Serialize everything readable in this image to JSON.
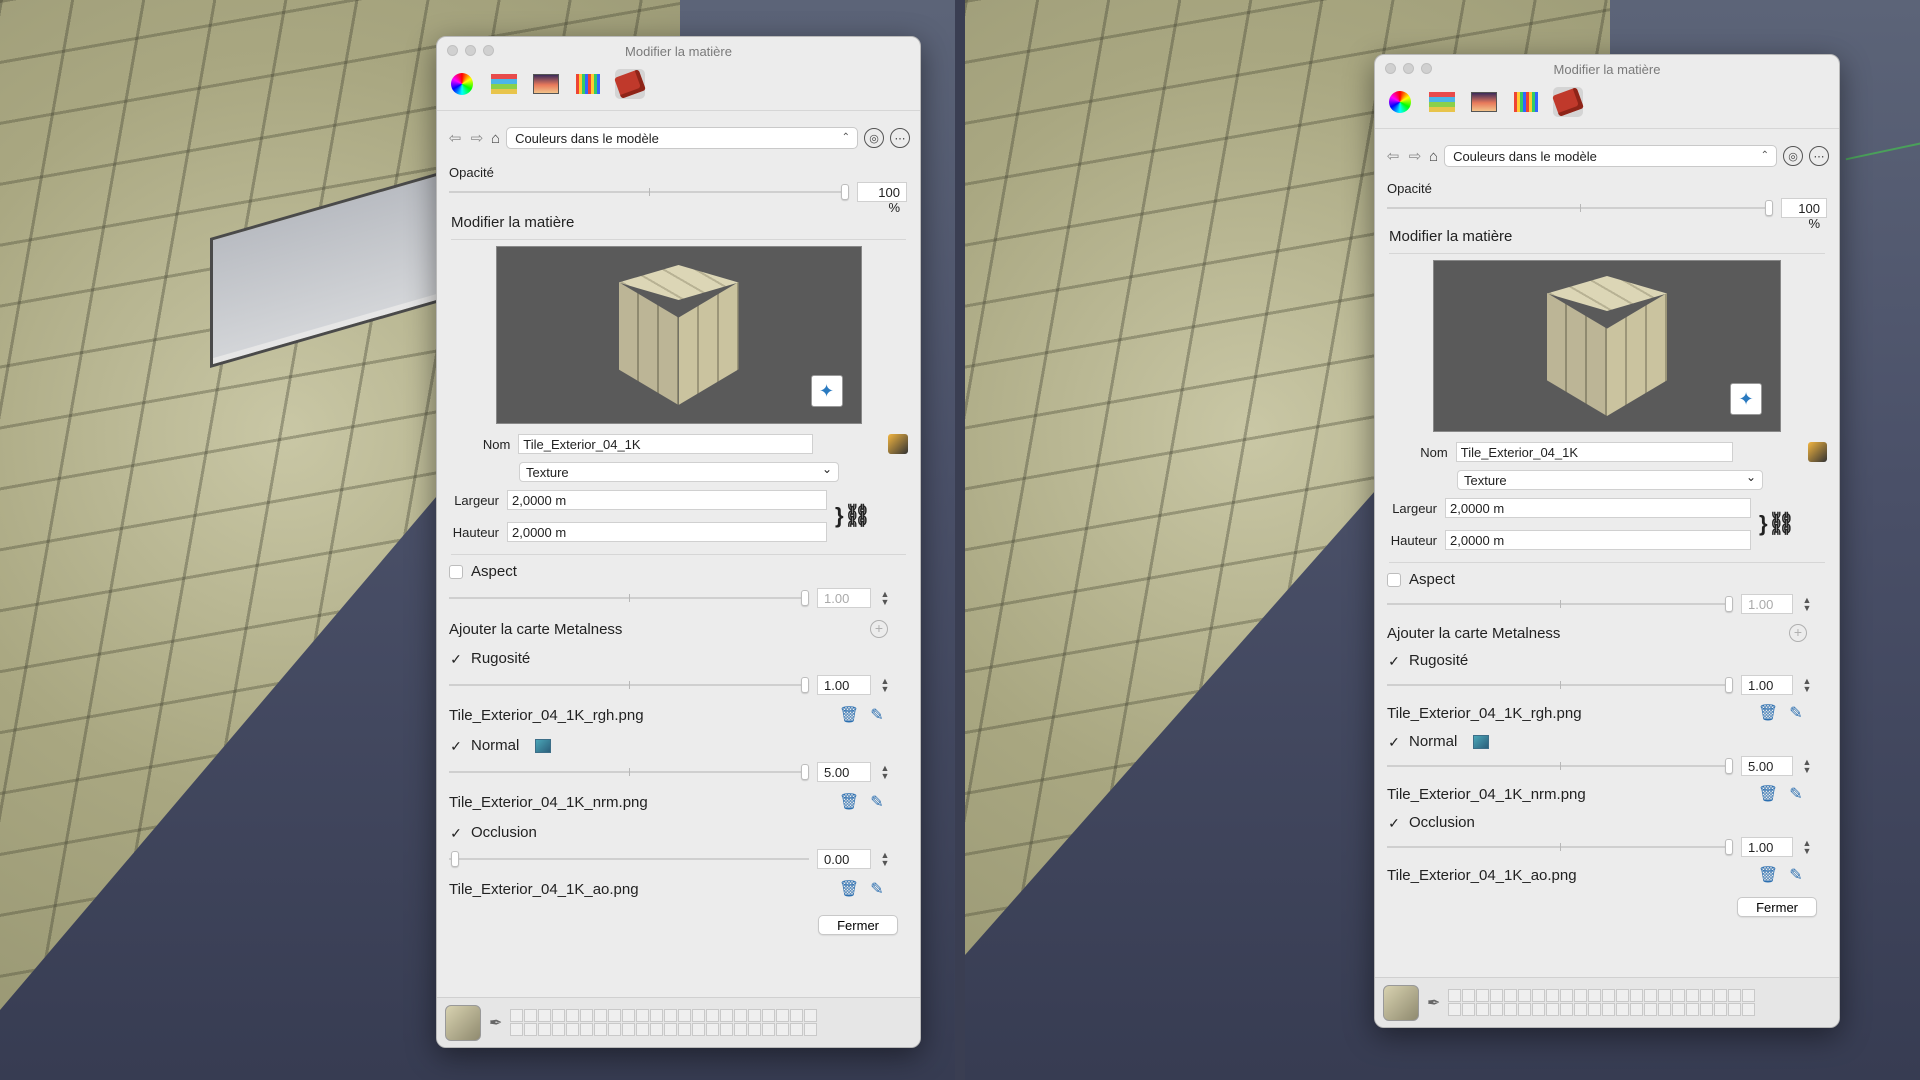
{
  "window_title": "Modifier la matière",
  "toolbar": {
    "icons": [
      "color-wheel-icon",
      "color-sliders-icon",
      "image-palette-icon",
      "crayons-icon",
      "materials-brick-icon"
    ]
  },
  "nav": {
    "collection": "Couleurs dans le modèle"
  },
  "panels": [
    {
      "opacity_label": "Opacité",
      "opacity_value": "100 %",
      "opacity_fraction": 1.0,
      "section_title": "Modifier la matière",
      "name_label": "Nom",
      "name_value": "Tile_Exterior_04_1K",
      "type_value": "Texture",
      "width_label": "Largeur",
      "width_value": "2,0000 m",
      "height_label": "Hauteur",
      "height_value": "2,0000 m",
      "aspect_label": "Aspect",
      "aspect_checked": false,
      "aspect_value": "1.00",
      "metalness_label": "Ajouter la carte Metalness",
      "roughness_label": "Rugosité",
      "roughness_checked": true,
      "roughness_value": "1.00",
      "roughness_file": "Tile_Exterior_04_1K_rgh.png",
      "normal_label": "Normal",
      "normal_checked": true,
      "normal_value": "5.00",
      "normal_file": "Tile_Exterior_04_1K_nrm.png",
      "occlusion_label": "Occlusion",
      "occlusion_checked": true,
      "occlusion_value": "0.00",
      "occlusion_file": "Tile_Exterior_04_1K_ao.png",
      "close_label": "Fermer"
    },
    {
      "opacity_label": "Opacité",
      "opacity_value": "100 %",
      "opacity_fraction": 1.0,
      "section_title": "Modifier la matière",
      "name_label": "Nom",
      "name_value": "Tile_Exterior_04_1K",
      "type_value": "Texture",
      "width_label": "Largeur",
      "width_value": "2,0000 m",
      "height_label": "Hauteur",
      "height_value": "2,0000 m",
      "aspect_label": "Aspect",
      "aspect_checked": false,
      "aspect_value": "1.00",
      "metalness_label": "Ajouter la carte Metalness",
      "roughness_label": "Rugosité",
      "roughness_checked": true,
      "roughness_value": "1.00",
      "roughness_file": "Tile_Exterior_04_1K_rgh.png",
      "normal_label": "Normal",
      "normal_checked": true,
      "normal_value": "5.00",
      "normal_file": "Tile_Exterior_04_1K_nrm.png",
      "occlusion_label": "Occlusion",
      "occlusion_checked": true,
      "occlusion_value": "1.00",
      "occlusion_file": "Tile_Exterior_04_1K_ao.png",
      "close_label": "Fermer"
    }
  ],
  "colors": {
    "accent": "#2c6fb0",
    "dialog_bg": "#ececec",
    "viewport_bg": "#3a3e52"
  }
}
